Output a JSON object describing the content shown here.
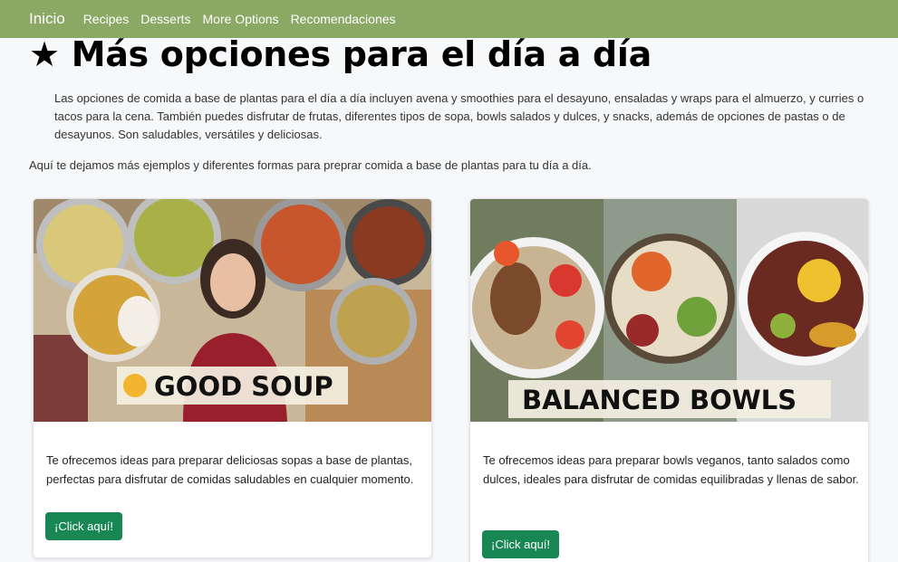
{
  "nav": {
    "brand": "Inicio",
    "links": [
      "Recipes",
      "Desserts",
      "More Options",
      "Recomendaciones"
    ]
  },
  "page": {
    "title": "★ Más opciones para el día a día",
    "intro": "Las opciones de comida a base de plantas para el día a día incluyen avena y smoothies para el desayuno, ensaladas y wraps para el almuerzo, y curries o tacos para la cena. También puedes disfrutar de frutas, diferentes tipos de sopa, bowls salados y dulces, y snacks, además de opciones de pastas o de desayunos. Son saludables, versátiles y deliciosas.",
    "lead": "Aquí te dejamos más ejemplos y diferentes formas para preprar comida a base de plantas para tu día a día."
  },
  "cards": [
    {
      "image_text": "GOOD SOUP",
      "description": "Te ofrecemos ideas para preparar deliciosas sopas a base de plantas, perfectas para disfrutar de comidas saludables en cualquier momento.",
      "button": "¡Click aquí!"
    },
    {
      "image_text": "BALANCED BOWLS",
      "description": "Te ofrecemos ideas para preparar bowls veganos, tanto salados como dulces, ideales para disfrutar de comidas equilibradas y llenas de sabor.",
      "button": "¡Click aquí!"
    }
  ],
  "colors": {
    "navbar": "#8ba865",
    "button": "#198754",
    "background": "#f7f8fa"
  },
  "icons": {
    "title": "star-icon",
    "soup_banner": "ok-hand-icon"
  }
}
